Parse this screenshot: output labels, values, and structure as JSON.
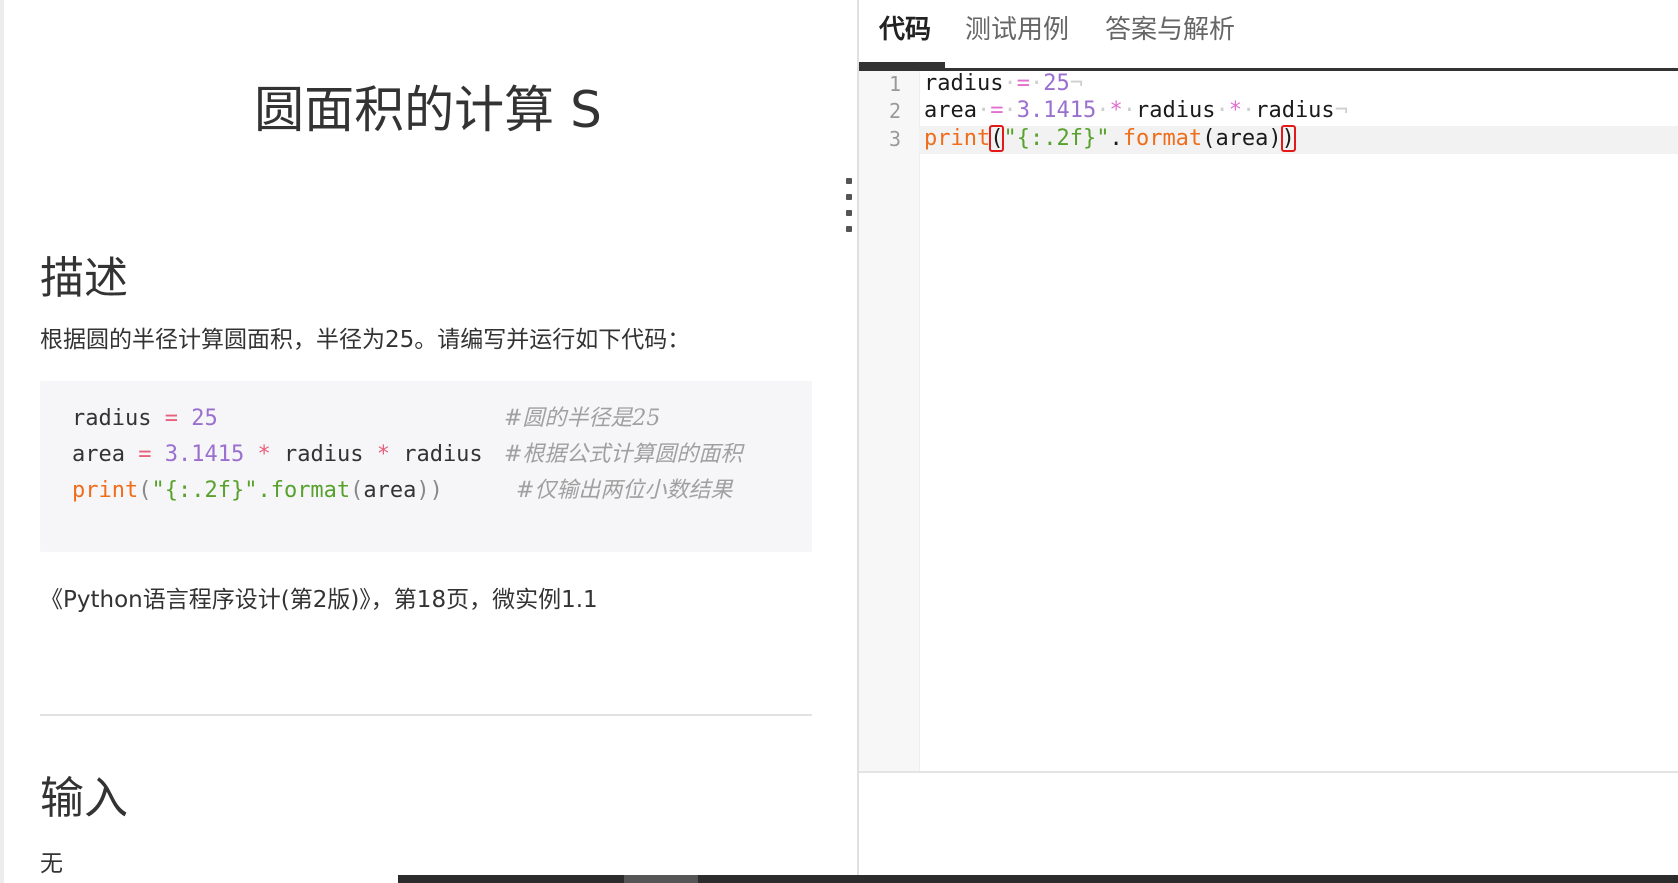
{
  "problem": {
    "title": "圆面积的计算 S",
    "description_heading": "描述",
    "description_text": "根据圆的半径计算圆面积，半径为25。请编写并运行如下代码：",
    "sample_code": {
      "line1": {
        "code_a": "radius",
        "code_b": " = ",
        "code_c": "25",
        "comment": "#圆的半径是25"
      },
      "line2": {
        "code_a": "area",
        "code_b": " = ",
        "code_c": "3.1415",
        "code_d": " * ",
        "code_e": "radius",
        "code_f": " * ",
        "code_g": "radius",
        "comment": "#根据公式计算圆的面积"
      },
      "line3": {
        "code_a": "print",
        "code_b": "(",
        "code_c": "\"{:.2f}\"",
        "code_d": ".format",
        "code_e": "(",
        "code_f": "area",
        "code_g": "))",
        "comment": "#仅输出两位小数结果"
      }
    },
    "reference": "《Python语言程序设计(第2版)》，第18页，微实例1.1",
    "input_heading": "输入",
    "input_text": "无"
  },
  "editor": {
    "tabs": [
      {
        "label": "代码",
        "active": true
      },
      {
        "label": "测试用例",
        "active": false
      },
      {
        "label": "答案与解析",
        "active": false
      }
    ],
    "line_numbers": [
      "1",
      "2",
      "3"
    ],
    "code": {
      "l1": {
        "a": "radius",
        "b": "=",
        "c": "25"
      },
      "l2": {
        "a": "area",
        "b": "=",
        "c": "3.1415",
        "d": "*",
        "e": "radius",
        "f": "*",
        "g": "radius"
      },
      "l3": {
        "a": "print",
        "b": "(",
        "c": "\"{:.2f}\"",
        "d": ".",
        "e": "format",
        "f": "(",
        "g": "area",
        "h": ")",
        "i": ")"
      }
    }
  }
}
